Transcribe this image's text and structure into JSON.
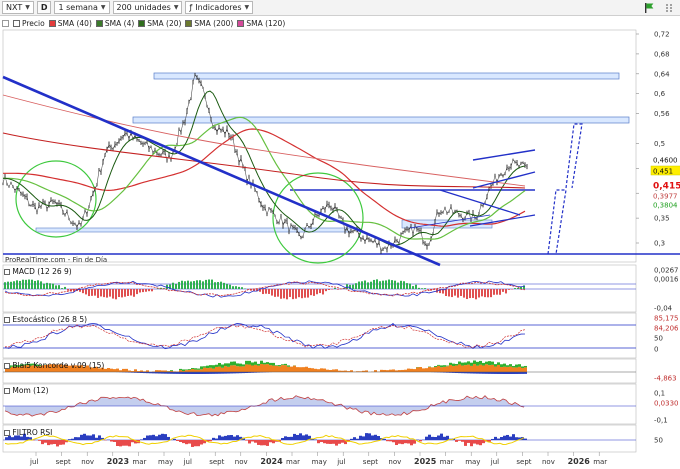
{
  "toolbar": {
    "symbol": "NXT",
    "d_label": "D",
    "period": "1 semana",
    "units": "200 unidades",
    "indicators": "Indicadores"
  },
  "legend": [
    {
      "label": "Precio",
      "color": "#ffffff"
    },
    {
      "label": "SMA (40)",
      "color": "#e33b3b"
    },
    {
      "label": "SMA (4)",
      "color": "#3a7a2a"
    },
    {
      "label": "SMA (20)",
      "color": "#2f6d1c"
    },
    {
      "label": "SMA (200)",
      "color": "#6c7a2e"
    },
    {
      "label": "SMA (120)",
      "color": "#d44a9a"
    }
  ],
  "price_axis": {
    "ticks": [
      "0,72",
      "0,68",
      "0,64",
      "0,6",
      "0,56",
      "0,5",
      "0,45",
      "0,4",
      "0,35",
      "0,3"
    ],
    "markers": [
      {
        "text": "0,4600",
        "bg": "#ffffff",
        "fg": "#111111"
      },
      {
        "text": "0,451",
        "bg": "#ffee00",
        "fg": "#111111"
      },
      {
        "text": "0,415",
        "bg": "#ffffff",
        "fg": "#e01010"
      },
      {
        "text": "0,3977",
        "bg": "#ffffff",
        "fg": "#c04040"
      },
      {
        "text": "0,3804",
        "bg": "#ffffff",
        "fg": "#20a020"
      }
    ]
  },
  "source_label": "ProRealTime.com - Fin de Día",
  "panels": {
    "macd": {
      "title": "MACD (12 26 9)",
      "ticks": [
        "0,0267",
        "0,0016",
        "-0,04"
      ]
    },
    "stoch": {
      "title": "Estocástico (26 8 5)",
      "ticks": [
        "85,175",
        "84,206",
        "50",
        "0"
      ]
    },
    "koncorde": {
      "title": "Blai5 Koncorde v.09 (15)",
      "ticks": [
        "-4,863"
      ]
    },
    "mom": {
      "title": "Mom (12)",
      "ticks": [
        "0,1",
        "0,0330",
        "-0,1"
      ]
    },
    "rsi": {
      "title": "FILTRO RSI",
      "ticks": [
        "50"
      ]
    }
  },
  "x_axis": [
    "jul",
    "sept",
    "nov",
    "2023",
    "mar",
    "may",
    "jul",
    "sept",
    "nov",
    "2024",
    "mar",
    "may",
    "jul",
    "sept",
    "nov",
    "2025",
    "mar",
    "may",
    "jul",
    "sept",
    "nov",
    "2026",
    "mar"
  ],
  "colors": {
    "price": "#222222",
    "trend": "#2230c8",
    "sma40": "#d43030",
    "sma4": "#2f8a20",
    "sma20": "#1a5a10",
    "macd_pos": "#30b050",
    "macd_neg": "#e05050"
  }
}
